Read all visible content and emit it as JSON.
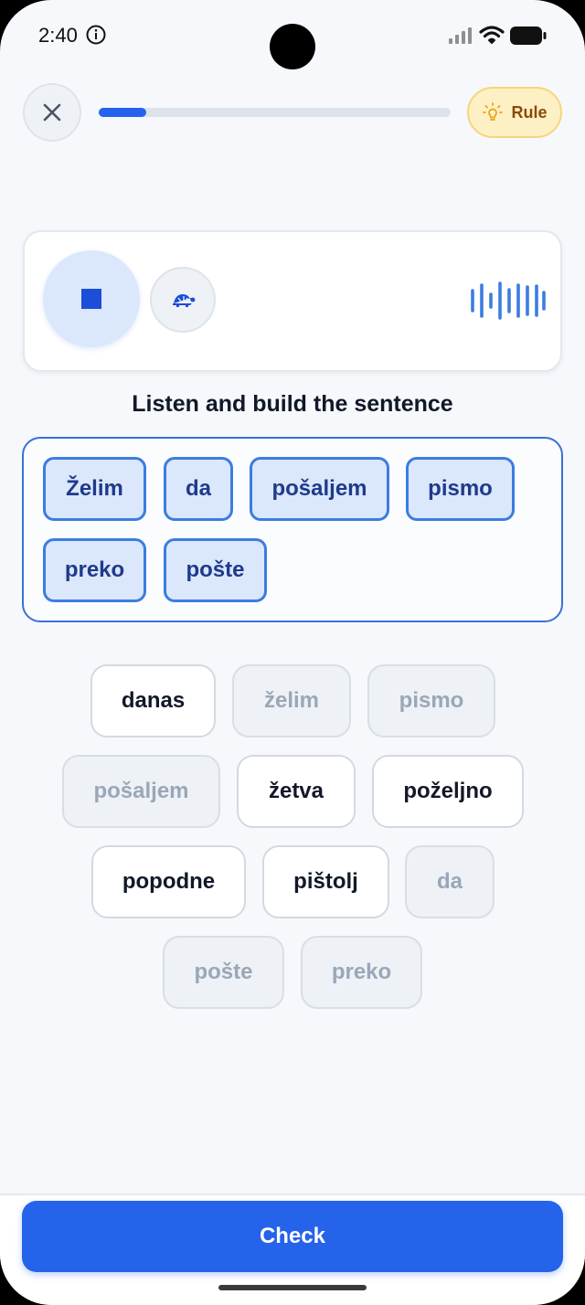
{
  "status_bar": {
    "time": "2:40"
  },
  "header": {
    "progress_fraction": 0.135,
    "rule_label": "Rule"
  },
  "colors": {
    "accent": "#2563eb",
    "rule_bg": "#fdf0c4",
    "rule_text": "#8a4a0b",
    "selected_chip_bg": "#dbe7fb"
  },
  "audio": {
    "icons": [
      "stop-icon",
      "turtle-icon",
      "sound-wave-icon"
    ]
  },
  "instruction": "Listen and build the sentence",
  "answer": {
    "words": [
      "Želim",
      "da",
      "pošaljem",
      "pismo",
      "preko",
      "pošte"
    ]
  },
  "word_bank": {
    "words": [
      {
        "text": "danas",
        "used": false
      },
      {
        "text": "želim",
        "used": true
      },
      {
        "text": "pismo",
        "used": true
      },
      {
        "text": "pošaljem",
        "used": true
      },
      {
        "text": "žetva",
        "used": false
      },
      {
        "text": "poželjno",
        "used": false
      },
      {
        "text": "popodne",
        "used": false
      },
      {
        "text": "pištolj",
        "used": false
      },
      {
        "text": "da",
        "used": true
      },
      {
        "text": "pošte",
        "used": true
      },
      {
        "text": "preko",
        "used": true
      }
    ]
  },
  "footer": {
    "check_label": "Check"
  }
}
